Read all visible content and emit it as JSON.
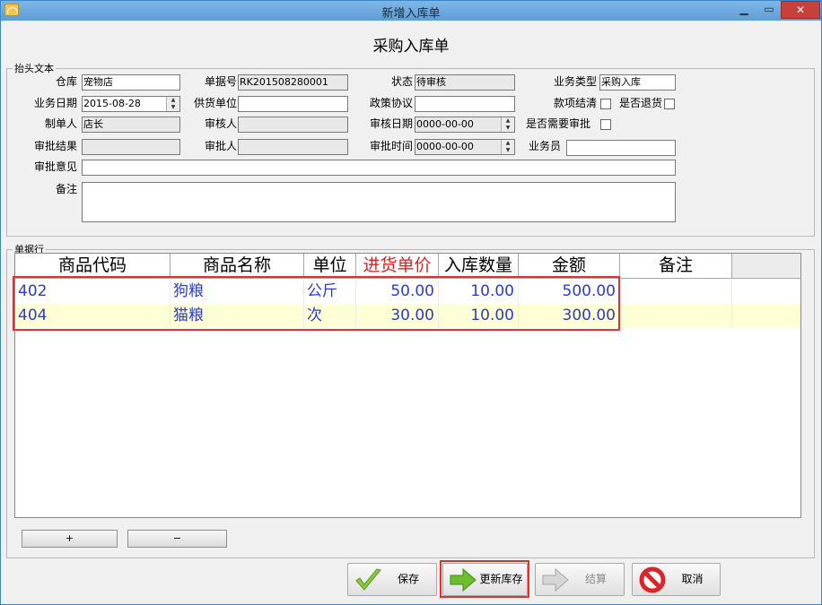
{
  "window": {
    "title": "新增入库单"
  },
  "form_title": "采购入库单",
  "header_section": {
    "legend": "抬头文本",
    "fields": {
      "warehouse": {
        "label": "仓库",
        "value": "宠物店"
      },
      "doc_no": {
        "label": "单据号",
        "value": "RK201508280001"
      },
      "status": {
        "label": "状态",
        "value": "待审核"
      },
      "biz_type": {
        "label": "业务类型",
        "value": "采购入库"
      },
      "biz_date": {
        "label": "业务日期",
        "value": "2015-08-28"
      },
      "supplier": {
        "label": "供货单位",
        "value": ""
      },
      "policy": {
        "label": "政策协议",
        "value": ""
      },
      "settled": {
        "label": "款项结清"
      },
      "returned": {
        "label": "是否退货"
      },
      "creator": {
        "label": "制单人",
        "value": "店长"
      },
      "reviewer": {
        "label": "审核人",
        "value": ""
      },
      "review_date": {
        "label": "审核日期",
        "value": "0000-00-00"
      },
      "need_approval": {
        "label": "是否需要审批"
      },
      "approval_result": {
        "label": "审批结果",
        "value": ""
      },
      "approver": {
        "label": "审批人",
        "value": ""
      },
      "approval_time": {
        "label": "审批时间",
        "value": "0000-00-00"
      },
      "salesman": {
        "label": "业务员",
        "value": ""
      },
      "approval_opinion": {
        "label": "审批意见",
        "value": ""
      },
      "remark": {
        "label": "备注",
        "value": ""
      }
    }
  },
  "lines_section": {
    "legend": "单据行",
    "columns": [
      "商品代码",
      "商品名称",
      "单位",
      "进货单价",
      "入库数量",
      "金额",
      "备注"
    ],
    "rows": [
      {
        "code": "402",
        "name": "狗粮",
        "unit": "公斤",
        "price": "50.00",
        "qty": "10.00",
        "amount": "500.00",
        "note": ""
      },
      {
        "code": "404",
        "name": "猫粮",
        "unit": "次",
        "price": "30.00",
        "qty": "10.00",
        "amount": "300.00",
        "note": ""
      }
    ]
  },
  "row_buttons": {
    "add": "+",
    "remove": "−"
  },
  "actions": {
    "save": "保存",
    "update_stock": "更新库存",
    "settle": "结算",
    "cancel": "取消"
  },
  "colors": {
    "highlight_red": "#e03030",
    "row_alt": "#ffffd6",
    "grid_text": "#2a3ad2"
  }
}
